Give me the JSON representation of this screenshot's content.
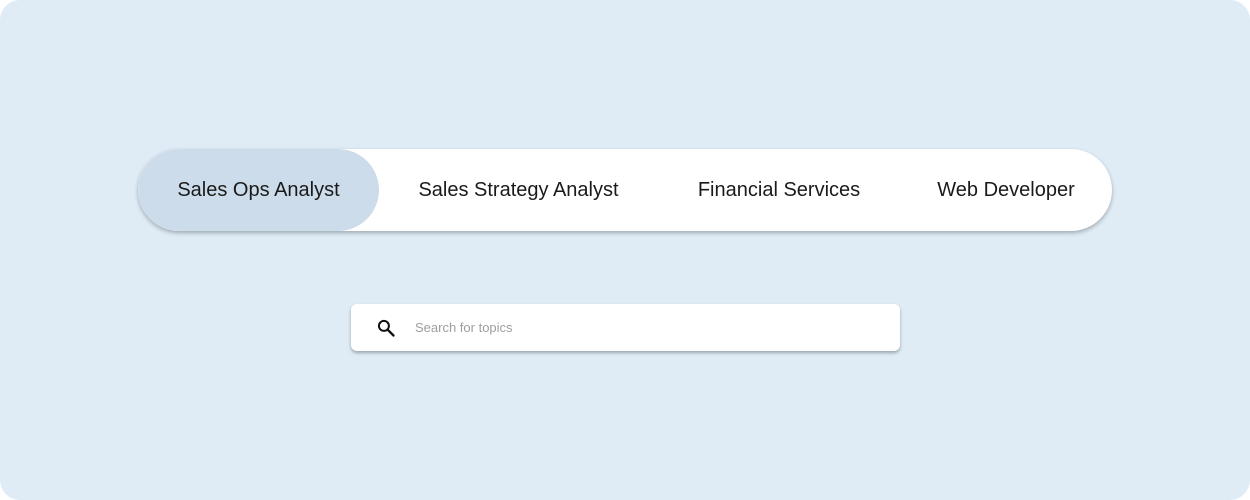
{
  "tabs": [
    {
      "label": "Sales Ops Analyst",
      "active": true
    },
    {
      "label": "Sales Strategy Analyst",
      "active": false
    },
    {
      "label": "Financial Services",
      "active": false
    },
    {
      "label": "Web Developer",
      "active": false
    }
  ],
  "search": {
    "placeholder": "Search for topics",
    "value": "",
    "icon": "search-icon"
  },
  "colors": {
    "background": "#dfebf5",
    "active_tab": "#cddcea",
    "surface": "#ffffff"
  }
}
